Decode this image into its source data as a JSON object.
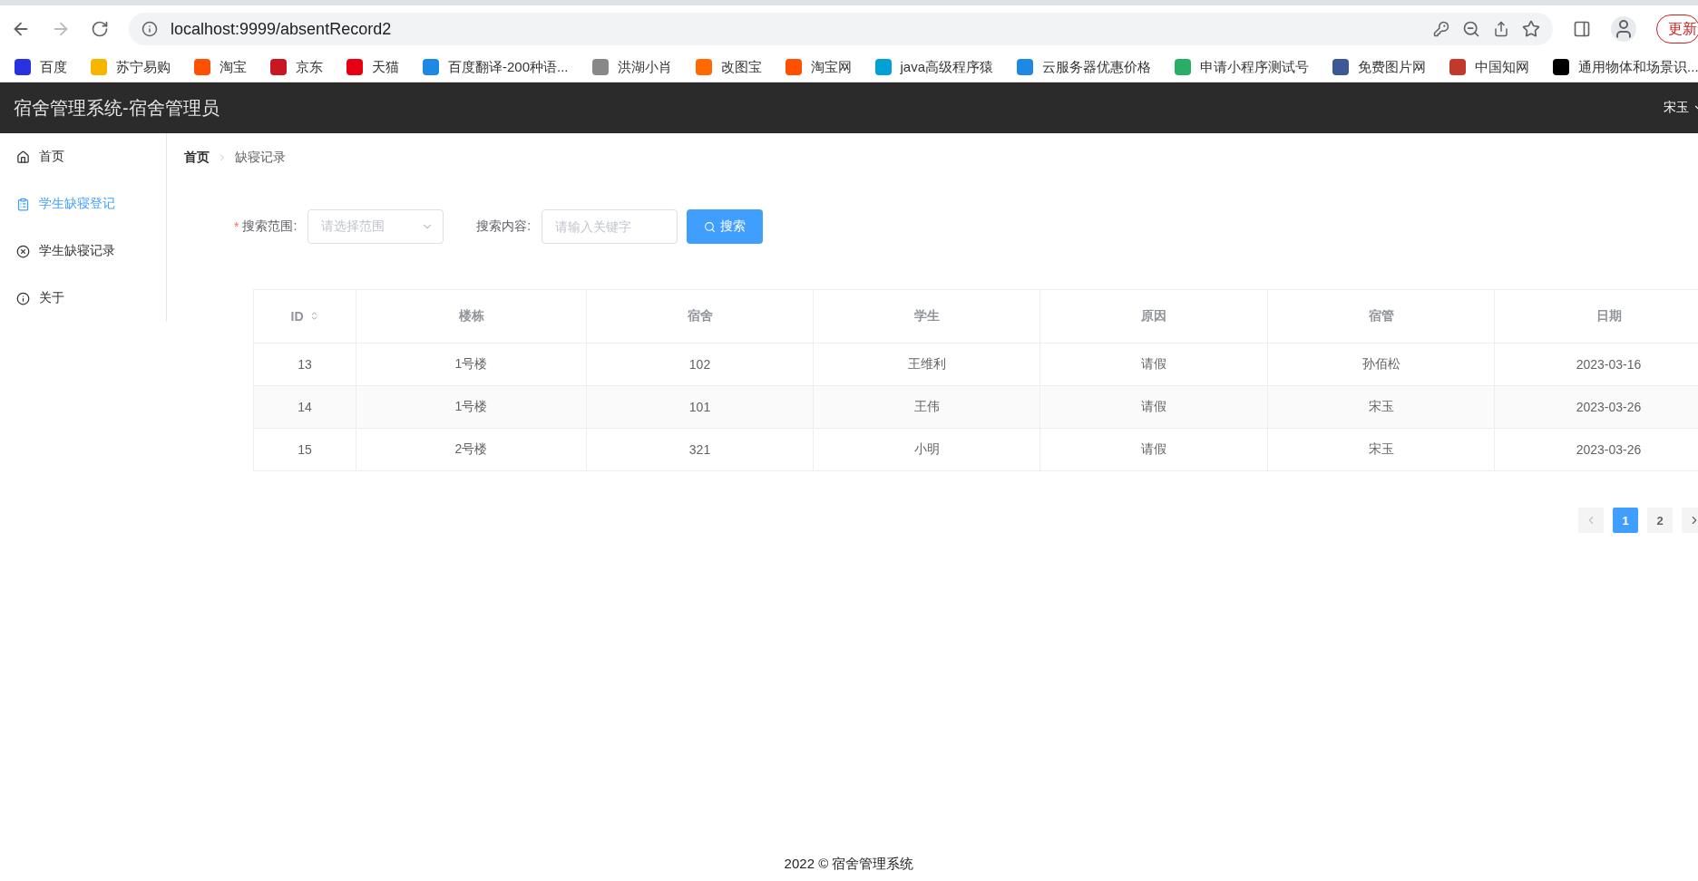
{
  "browser": {
    "url": "localhost:9999/absentRecord2",
    "update_button": "更新"
  },
  "bookmarks": [
    "百度",
    "苏宁易购",
    "淘宝",
    "京东",
    "天猫",
    "百度翻译-200种语...",
    "洪湖小肖",
    "改图宝",
    "淘宝网",
    "java高级程序猿",
    "云服务器优惠价格",
    "申请小程序测试号",
    "免费图片网",
    "中国知网",
    "通用物体和场景识..."
  ],
  "header": {
    "title": "宿舍管理系统-宿舍管理员",
    "user": "宋玉"
  },
  "sidebar": {
    "items": [
      {
        "label": "首页",
        "kind": "home",
        "selected": false
      },
      {
        "label": "学生缺寝登记",
        "kind": "clipboard",
        "selected": true
      },
      {
        "label": "学生缺寝记录",
        "kind": "cross",
        "selected": false
      },
      {
        "label": "关于",
        "kind": "info",
        "selected": false
      }
    ]
  },
  "breadcrumb": [
    "首页",
    "缺寝记录"
  ],
  "search": {
    "required_mark": "*",
    "range_label": "搜索范围:",
    "range_placeholder": "请选择范围",
    "content_label": "搜索内容:",
    "content_placeholder": "请输入关键字",
    "button": "搜索"
  },
  "table": {
    "columns": [
      "ID",
      "楼栋",
      "宿舍",
      "学生",
      "原因",
      "宿管",
      "日期"
    ],
    "rows": [
      [
        "13",
        "1号楼",
        "102",
        "王维利",
        "请假",
        "孙佰松",
        "2023-03-16"
      ],
      [
        "14",
        "1号楼",
        "101",
        "王伟",
        "请假",
        "宋玉",
        "2023-03-26"
      ],
      [
        "15",
        "2号楼",
        "321",
        "小明",
        "请假",
        "宋玉",
        "2023-03-26"
      ]
    ]
  },
  "pagination": {
    "pages": [
      {
        "label": "1",
        "selected": true
      },
      {
        "label": "2",
        "selected": false
      }
    ]
  },
  "footer": "2022 © 宿舍管理系统"
}
